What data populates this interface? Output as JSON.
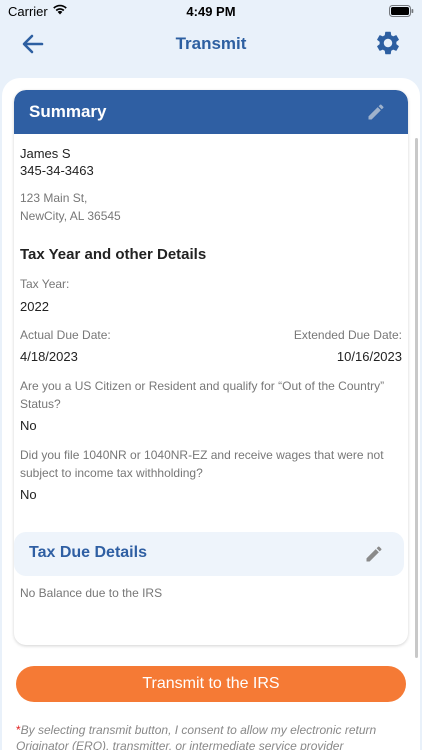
{
  "status_bar": {
    "carrier": "Carrier",
    "time": "4:49 PM"
  },
  "nav": {
    "title": "Transmit"
  },
  "summary": {
    "header": "Summary",
    "name": "James S",
    "ssn": "345-34-3463",
    "address_line1": "123 Main St,",
    "address_line2": "NewCity, AL 36545",
    "details_title": "Tax Year and other Details",
    "tax_year_label": "Tax Year:",
    "tax_year_value": "2022",
    "actual_due_label": "Actual Due Date:",
    "actual_due_value": "4/18/2023",
    "extended_due_label": "Extended Due Date:",
    "extended_due_value": "10/16/2023",
    "q1": "Are you a US Citizen or Resident and qualify for “Out of the Country” Status?",
    "a1": "No",
    "q2": "Did you file 1040NR or 1040NR-EZ and receive wages that were not subject to income tax withholding?",
    "a2": "No"
  },
  "tax_due": {
    "header": "Tax Due Details",
    "text": "No Balance due to the IRS"
  },
  "transmit_button": "Transmit to the IRS",
  "consent": "By selecting transmit button, I consent to allow my electronic return Originator (ERO), transmitter, or intermediate service provider",
  "colors": {
    "primary": "#2f5fa3",
    "accent": "#f57a35",
    "background": "#e9f1fa"
  }
}
